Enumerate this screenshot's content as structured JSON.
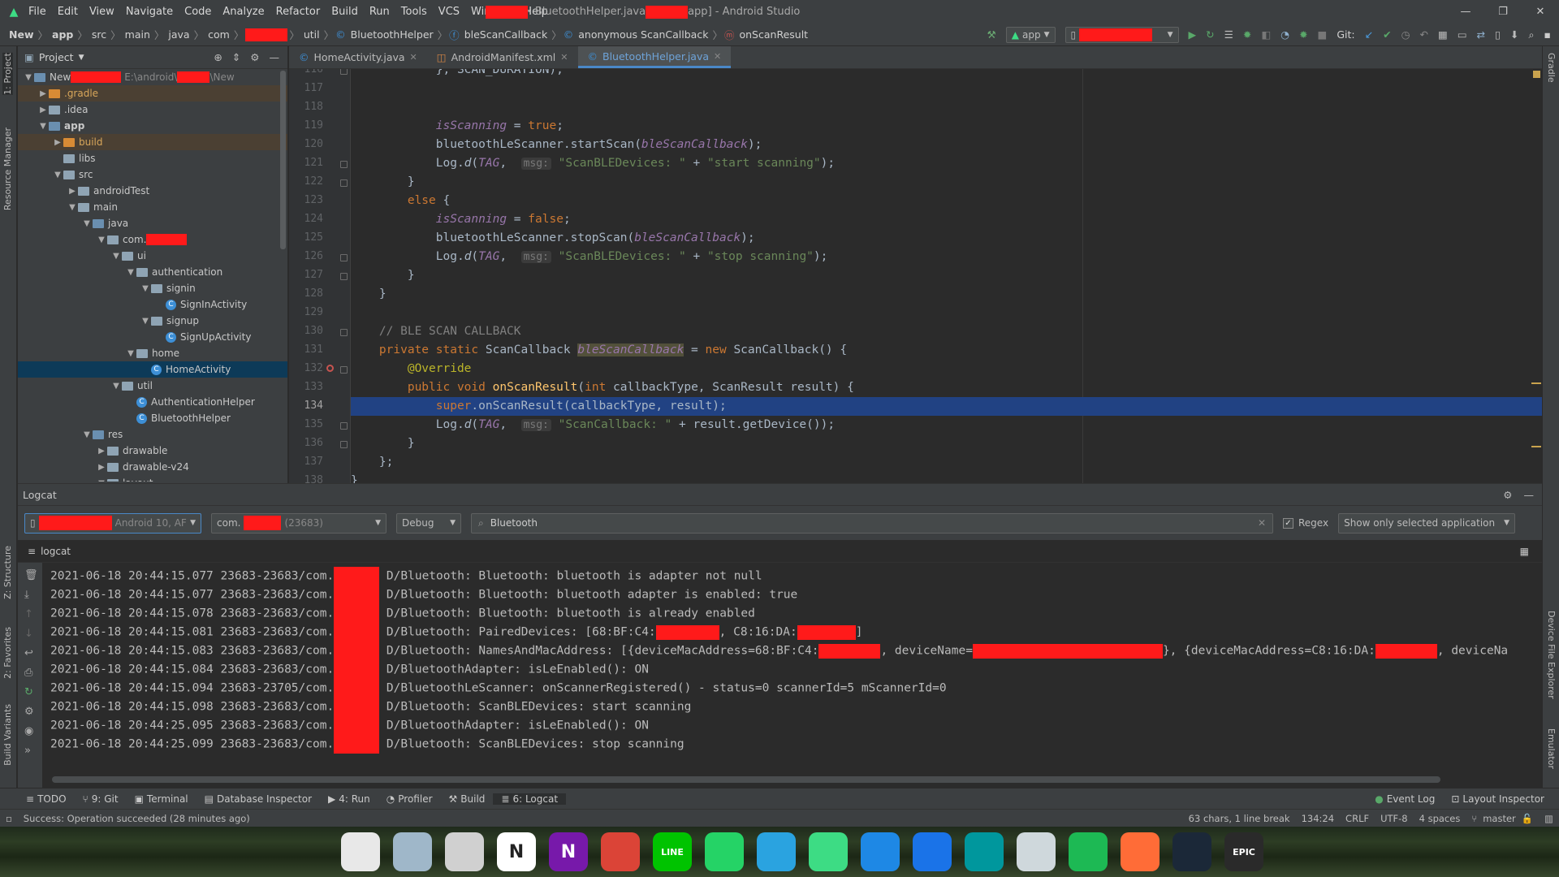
{
  "menubar": {
    "items": [
      "File",
      "Edit",
      "View",
      "Navigate",
      "Code",
      "Analyze",
      "Refactor",
      "Build",
      "Run",
      "Tools",
      "VCS",
      "Window",
      "Help"
    ],
    "title_file": " - BluetoothHelper.java ",
    "title_suffix": "app] - Android Studio",
    "controls": [
      "—",
      "❐",
      "✕"
    ]
  },
  "navbar": {
    "crumbs": [
      "New",
      "app",
      "src",
      "main",
      "java",
      "com",
      "util",
      "BluetoothHelper",
      "bleScanCallback",
      "anonymous ScanCallback",
      "onScanResult"
    ],
    "run_config": "app",
    "git_label": "Git:"
  },
  "project": {
    "header": "Project",
    "tree": [
      {
        "label": "New",
        "extra": "E:\\android\\",
        "extra2": "\\New",
        "depth": 0,
        "open": true,
        "kind": "folder-blue"
      },
      {
        "label": ".gradle",
        "depth": 1,
        "open": false,
        "kind": "folder-orange",
        "hl": true
      },
      {
        "label": ".idea",
        "depth": 1,
        "open": false,
        "kind": "folder"
      },
      {
        "label": "app",
        "depth": 1,
        "open": true,
        "kind": "folder-blue",
        "bold": true
      },
      {
        "label": "build",
        "depth": 2,
        "open": false,
        "kind": "folder-orange",
        "hl": true
      },
      {
        "label": "libs",
        "depth": 2,
        "kind": "folder"
      },
      {
        "label": "src",
        "depth": 2,
        "open": true,
        "kind": "folder"
      },
      {
        "label": "androidTest",
        "depth": 3,
        "open": false,
        "kind": "folder"
      },
      {
        "label": "main",
        "depth": 3,
        "open": true,
        "kind": "folder"
      },
      {
        "label": "java",
        "depth": 4,
        "open": true,
        "kind": "folder-blue"
      },
      {
        "label": "com.",
        "depth": 5,
        "open": true,
        "kind": "folder",
        "redact": true
      },
      {
        "label": "ui",
        "depth": 6,
        "open": true,
        "kind": "folder"
      },
      {
        "label": "authentication",
        "depth": 7,
        "open": true,
        "kind": "folder"
      },
      {
        "label": "signin",
        "depth": 8,
        "open": true,
        "kind": "folder"
      },
      {
        "label": "SignInActivity",
        "depth": 9,
        "kind": "class"
      },
      {
        "label": "signup",
        "depth": 8,
        "open": true,
        "kind": "folder"
      },
      {
        "label": "SignUpActivity",
        "depth": 9,
        "kind": "class"
      },
      {
        "label": "home",
        "depth": 7,
        "open": true,
        "kind": "folder"
      },
      {
        "label": "HomeActivity",
        "depth": 8,
        "kind": "class",
        "selected": true
      },
      {
        "label": "util",
        "depth": 6,
        "open": true,
        "kind": "folder"
      },
      {
        "label": "AuthenticationHelper",
        "depth": 7,
        "kind": "class"
      },
      {
        "label": "BluetoothHelper",
        "depth": 7,
        "kind": "class"
      },
      {
        "label": "res",
        "depth": 4,
        "open": true,
        "kind": "folder-res"
      },
      {
        "label": "drawable",
        "depth": 5,
        "open": false,
        "kind": "folder"
      },
      {
        "label": "drawable-v24",
        "depth": 5,
        "open": false,
        "kind": "folder"
      },
      {
        "label": "layout",
        "depth": 5,
        "open": true,
        "kind": "folder"
      }
    ]
  },
  "tabs": [
    {
      "label": "HomeActivity.java",
      "active": false
    },
    {
      "label": "AndroidManifest.xml",
      "active": false
    },
    {
      "label": "BluetoothHelper.java",
      "active": true
    }
  ],
  "editor": {
    "first_line": 116,
    "current_line": 134,
    "lines": [
      [
        {
          "t": "            }, SCAN_DURATION);",
          "c": ""
        }
      ],
      [
        {
          "t": "",
          "c": ""
        }
      ],
      [
        {
          "t": "",
          "c": ""
        }
      ],
      [
        {
          "t": "            ",
          "c": ""
        },
        {
          "t": "isScanning",
          "c": "fld"
        },
        {
          "t": " = ",
          "c": ""
        },
        {
          "t": "true",
          "c": "kw"
        },
        {
          "t": ";",
          "c": ""
        }
      ],
      [
        {
          "t": "            bluetoothLeScanner.startScan(",
          "c": ""
        },
        {
          "t": "bleScanCallback",
          "c": "fld"
        },
        {
          "t": ");",
          "c": ""
        }
      ],
      [
        {
          "t": "            Log.",
          "c": ""
        },
        {
          "t": "d",
          "c": "it"
        },
        {
          "t": "(",
          "c": ""
        },
        {
          "t": "TAG",
          "c": "fld"
        },
        {
          "t": ",  ",
          "c": ""
        },
        {
          "t": "msg:",
          "c": "hint"
        },
        {
          "t": " ",
          "c": ""
        },
        {
          "t": "\"ScanBLEDevices: \"",
          "c": "str"
        },
        {
          "t": " + ",
          "c": ""
        },
        {
          "t": "\"start scanning\"",
          "c": "str"
        },
        {
          "t": ");",
          "c": ""
        }
      ],
      [
        {
          "t": "        }",
          "c": ""
        }
      ],
      [
        {
          "t": "        ",
          "c": ""
        },
        {
          "t": "else",
          "c": "kw"
        },
        {
          "t": " {",
          "c": ""
        }
      ],
      [
        {
          "t": "            ",
          "c": ""
        },
        {
          "t": "isScanning",
          "c": "fld"
        },
        {
          "t": " = ",
          "c": ""
        },
        {
          "t": "false",
          "c": "kw"
        },
        {
          "t": ";",
          "c": ""
        }
      ],
      [
        {
          "t": "            bluetoothLeScanner.stopScan(",
          "c": ""
        },
        {
          "t": "bleScanCallback",
          "c": "fld"
        },
        {
          "t": ");",
          "c": ""
        }
      ],
      [
        {
          "t": "            Log.",
          "c": ""
        },
        {
          "t": "d",
          "c": "it"
        },
        {
          "t": "(",
          "c": ""
        },
        {
          "t": "TAG",
          "c": "fld"
        },
        {
          "t": ",  ",
          "c": ""
        },
        {
          "t": "msg:",
          "c": "hint"
        },
        {
          "t": " ",
          "c": ""
        },
        {
          "t": "\"ScanBLEDevices: \"",
          "c": "str"
        },
        {
          "t": " + ",
          "c": ""
        },
        {
          "t": "\"stop scanning\"",
          "c": "str"
        },
        {
          "t": ");",
          "c": ""
        }
      ],
      [
        {
          "t": "        }",
          "c": ""
        }
      ],
      [
        {
          "t": "    }",
          "c": ""
        }
      ],
      [
        {
          "t": "",
          "c": ""
        }
      ],
      [
        {
          "t": "    ",
          "c": ""
        },
        {
          "t": "// BLE SCAN CALLBACK",
          "c": "cmt"
        }
      ],
      [
        {
          "t": "    ",
          "c": ""
        },
        {
          "t": "private static",
          "c": "kw"
        },
        {
          "t": " ScanCallback ",
          "c": ""
        },
        {
          "t": "bleScanCallback",
          "c": "fldhl"
        },
        {
          "t": " = ",
          "c": ""
        },
        {
          "t": "new",
          "c": "kw"
        },
        {
          "t": " ScanCallback() {",
          "c": ""
        }
      ],
      [
        {
          "t": "        ",
          "c": ""
        },
        {
          "t": "@Override",
          "c": "ann"
        }
      ],
      [
        {
          "t": "        ",
          "c": ""
        },
        {
          "t": "public void",
          "c": "kw"
        },
        {
          "t": " ",
          "c": ""
        },
        {
          "t": "onScanResult",
          "c": "fn"
        },
        {
          "t": "(",
          "c": ""
        },
        {
          "t": "int",
          "c": "kw"
        },
        {
          "t": " callbackType, ScanResult result) {",
          "c": ""
        }
      ],
      [
        {
          "t": "            ",
          "c": ""
        },
        {
          "t": "super",
          "c": "kw"
        },
        {
          "t": ".onScanResult(callbackType, result);",
          "c": ""
        }
      ],
      [
        {
          "t": "            Log.",
          "c": ""
        },
        {
          "t": "d",
          "c": "it"
        },
        {
          "t": "(",
          "c": ""
        },
        {
          "t": "TAG",
          "c": "fld"
        },
        {
          "t": ",  ",
          "c": ""
        },
        {
          "t": "msg:",
          "c": "hint"
        },
        {
          "t": " ",
          "c": ""
        },
        {
          "t": "\"ScanCallback: \"",
          "c": "str"
        },
        {
          "t": " + result.getDevice());",
          "c": ""
        }
      ],
      [
        {
          "t": "        }",
          "c": ""
        }
      ],
      [
        {
          "t": "    };",
          "c": ""
        }
      ],
      [
        {
          "t": "}",
          "c": ""
        }
      ]
    ]
  },
  "logcat": {
    "title": "Logcat",
    "device_suffix": "Android 10, AF",
    "process_prefix": "com.",
    "process_pid": "(23683)",
    "level": "Debug",
    "search": "Bluetooth",
    "regex_label": "Regex",
    "scope": "Show only selected application",
    "sub_label": "logcat",
    "lines": [
      {
        "prefix": "2021-06-18 20:44:15.077 23683-23683/com.",
        "msg": "D/Bluetooth: Bluetooth: bluetooth is adapter not null"
      },
      {
        "prefix": "2021-06-18 20:44:15.077 23683-23683/com.",
        "msg": "D/Bluetooth: Bluetooth: bluetooth adapter is enabled: true"
      },
      {
        "prefix": "2021-06-18 20:44:15.078 23683-23683/com.",
        "msg": "D/Bluetooth: Bluetooth: bluetooth is already enabled"
      },
      {
        "prefix": "2021-06-18 20:44:15.081 23683-23683/com.",
        "msg": "D/Bluetooth: PairedDevices: [68:BF:C4:",
        "r1": 78,
        "msg2": ", C8:16:DA:",
        "r2": 72,
        "msg3": "]"
      },
      {
        "prefix": "2021-06-18 20:44:15.083 23683-23683/com.",
        "msg": "D/Bluetooth: NamesAndMacAddress: [{deviceMacAddress=68:BF:C4:",
        "r1": 76,
        "msg2": ", deviceName=",
        "r2": 234,
        "msg3": "}, {deviceMacAddress=C8:16:DA:",
        "r3": 76,
        "msg4": ", deviceNa"
      },
      {
        "prefix": "2021-06-18 20:44:15.084 23683-23683/com.",
        "msg": "D/BluetoothAdapter: isLeEnabled(): ON"
      },
      {
        "prefix": "2021-06-18 20:44:15.094 23683-23705/com.",
        "msg": "D/BluetoothLeScanner: onScannerRegistered() - status=0 scannerId=5 mScannerId=0"
      },
      {
        "prefix": "2021-06-18 20:44:15.098 23683-23683/com.",
        "msg": "D/Bluetooth: ScanBLEDevices: start scanning"
      },
      {
        "prefix": "2021-06-18 20:44:25.095 23683-23683/com.",
        "msg": "D/BluetoothAdapter: isLeEnabled(): ON"
      },
      {
        "prefix": "2021-06-18 20:44:25.099 23683-23683/com.",
        "msg": "D/Bluetooth: ScanBLEDevices: stop scanning"
      }
    ]
  },
  "toolwindows": [
    {
      "label": "TODO",
      "icon": "≡"
    },
    {
      "label": "9: Git",
      "icon": "⑂"
    },
    {
      "label": "Terminal",
      "icon": "▣"
    },
    {
      "label": "Database Inspector",
      "icon": "▤"
    },
    {
      "label": "4: Run",
      "icon": "▶"
    },
    {
      "label": "Profiler",
      "icon": "◔"
    },
    {
      "label": "Build",
      "icon": "⚒"
    },
    {
      "label": "6: Logcat",
      "icon": "≣",
      "active": true
    }
  ],
  "toolwindows_right": [
    {
      "label": "Event Log",
      "icon": "●"
    },
    {
      "label": "Layout Inspector",
      "icon": "⊡"
    }
  ],
  "status": {
    "message": "Success: Operation succeeded (28 minutes ago)",
    "selection": "63 chars, 1 line break",
    "position": "134:24",
    "line_sep": "CRLF",
    "encoding": "UTF-8",
    "indent": "4 spaces",
    "branch": "master"
  },
  "side": {
    "left": [
      "1: Project",
      "Resource Manager",
      "Z: Structure",
      "2: Favorites",
      "Build Variants"
    ],
    "right": [
      "Gradle",
      "Device File Explorer",
      "Emulator"
    ]
  },
  "dock": [
    {
      "name": "clock-icon",
      "color": "#e8e8e8"
    },
    {
      "name": "trash-icon",
      "color": "#9fb7c9"
    },
    {
      "name": "snipping-tool-icon",
      "color": "#d0d0d0"
    },
    {
      "name": "notion-icon",
      "color": "#ffffff",
      "glyph": "N"
    },
    {
      "name": "onenote-icon",
      "color": "#7719aa",
      "glyph": "N"
    },
    {
      "name": "chrome-icon",
      "color": "#db4437"
    },
    {
      "name": "line-icon",
      "color": "#00c300",
      "glyph": "LINE"
    },
    {
      "name": "whatsapp-icon",
      "color": "#25d366"
    },
    {
      "name": "telegram-icon",
      "color": "#2aa3e0"
    },
    {
      "name": "android-studio-icon",
      "color": "#3ddc84"
    },
    {
      "name": "vscode-icon",
      "color": "#1e88e5"
    },
    {
      "name": "maps-icon",
      "color": "#1a73e8"
    },
    {
      "name": "arduino-icon",
      "color": "#00979d"
    },
    {
      "name": "finder-icon",
      "color": "#cfd8dc"
    },
    {
      "name": "spotify-icon",
      "color": "#1db954"
    },
    {
      "name": "postman-icon",
      "color": "#ff6c37"
    },
    {
      "name": "steam-icon",
      "color": "#1b2838"
    },
    {
      "name": "epic-games-icon",
      "color": "#2a2a2a",
      "glyph": "EPIC"
    }
  ]
}
